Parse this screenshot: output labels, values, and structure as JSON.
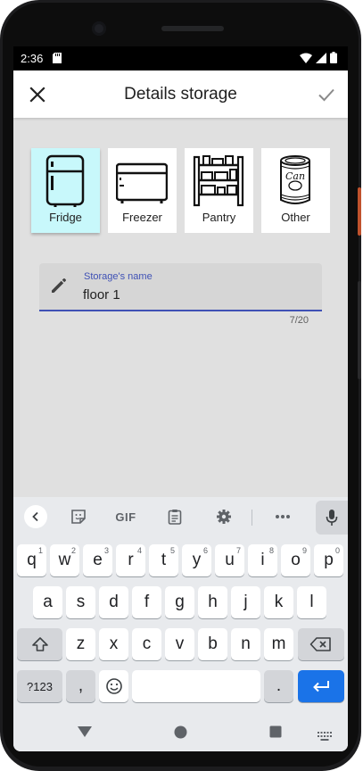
{
  "status_bar": {
    "time": "2:36"
  },
  "app_bar": {
    "title": "Details storage",
    "close_icon": "close-icon",
    "confirm_icon": "check-icon"
  },
  "storage_types": [
    {
      "label": "Fridge",
      "icon": "fridge-icon",
      "selected": true
    },
    {
      "label": "Freezer",
      "icon": "freezer-icon",
      "selected": false
    },
    {
      "label": "Pantry",
      "icon": "pantry-icon",
      "selected": false
    },
    {
      "label": "Other",
      "icon": "can-icon",
      "selected": false,
      "icon_text": "Can"
    }
  ],
  "name_field": {
    "label": "Storage's name",
    "value": "floor 1",
    "counter": "7/20"
  },
  "keyboard": {
    "toolbar": {
      "gif_label": "GIF"
    },
    "row1": [
      {
        "key": "q",
        "hint": "1"
      },
      {
        "key": "w",
        "hint": "2"
      },
      {
        "key": "e",
        "hint": "3"
      },
      {
        "key": "r",
        "hint": "4"
      },
      {
        "key": "t",
        "hint": "5"
      },
      {
        "key": "y",
        "hint": "6"
      },
      {
        "key": "u",
        "hint": "7"
      },
      {
        "key": "i",
        "hint": "8"
      },
      {
        "key": "o",
        "hint": "9"
      },
      {
        "key": "p",
        "hint": "0"
      }
    ],
    "row2": [
      "a",
      "s",
      "d",
      "f",
      "g",
      "h",
      "j",
      "k",
      "l"
    ],
    "row3": [
      "z",
      "x",
      "c",
      "v",
      "b",
      "n",
      "m"
    ],
    "row4": {
      "symbols_label": "?123",
      "comma_label": ",",
      "period_label": "."
    }
  },
  "colors": {
    "accent": "#3f51b5",
    "selected_tile": "#c8f8fb",
    "enter_key": "#1a73e8"
  }
}
